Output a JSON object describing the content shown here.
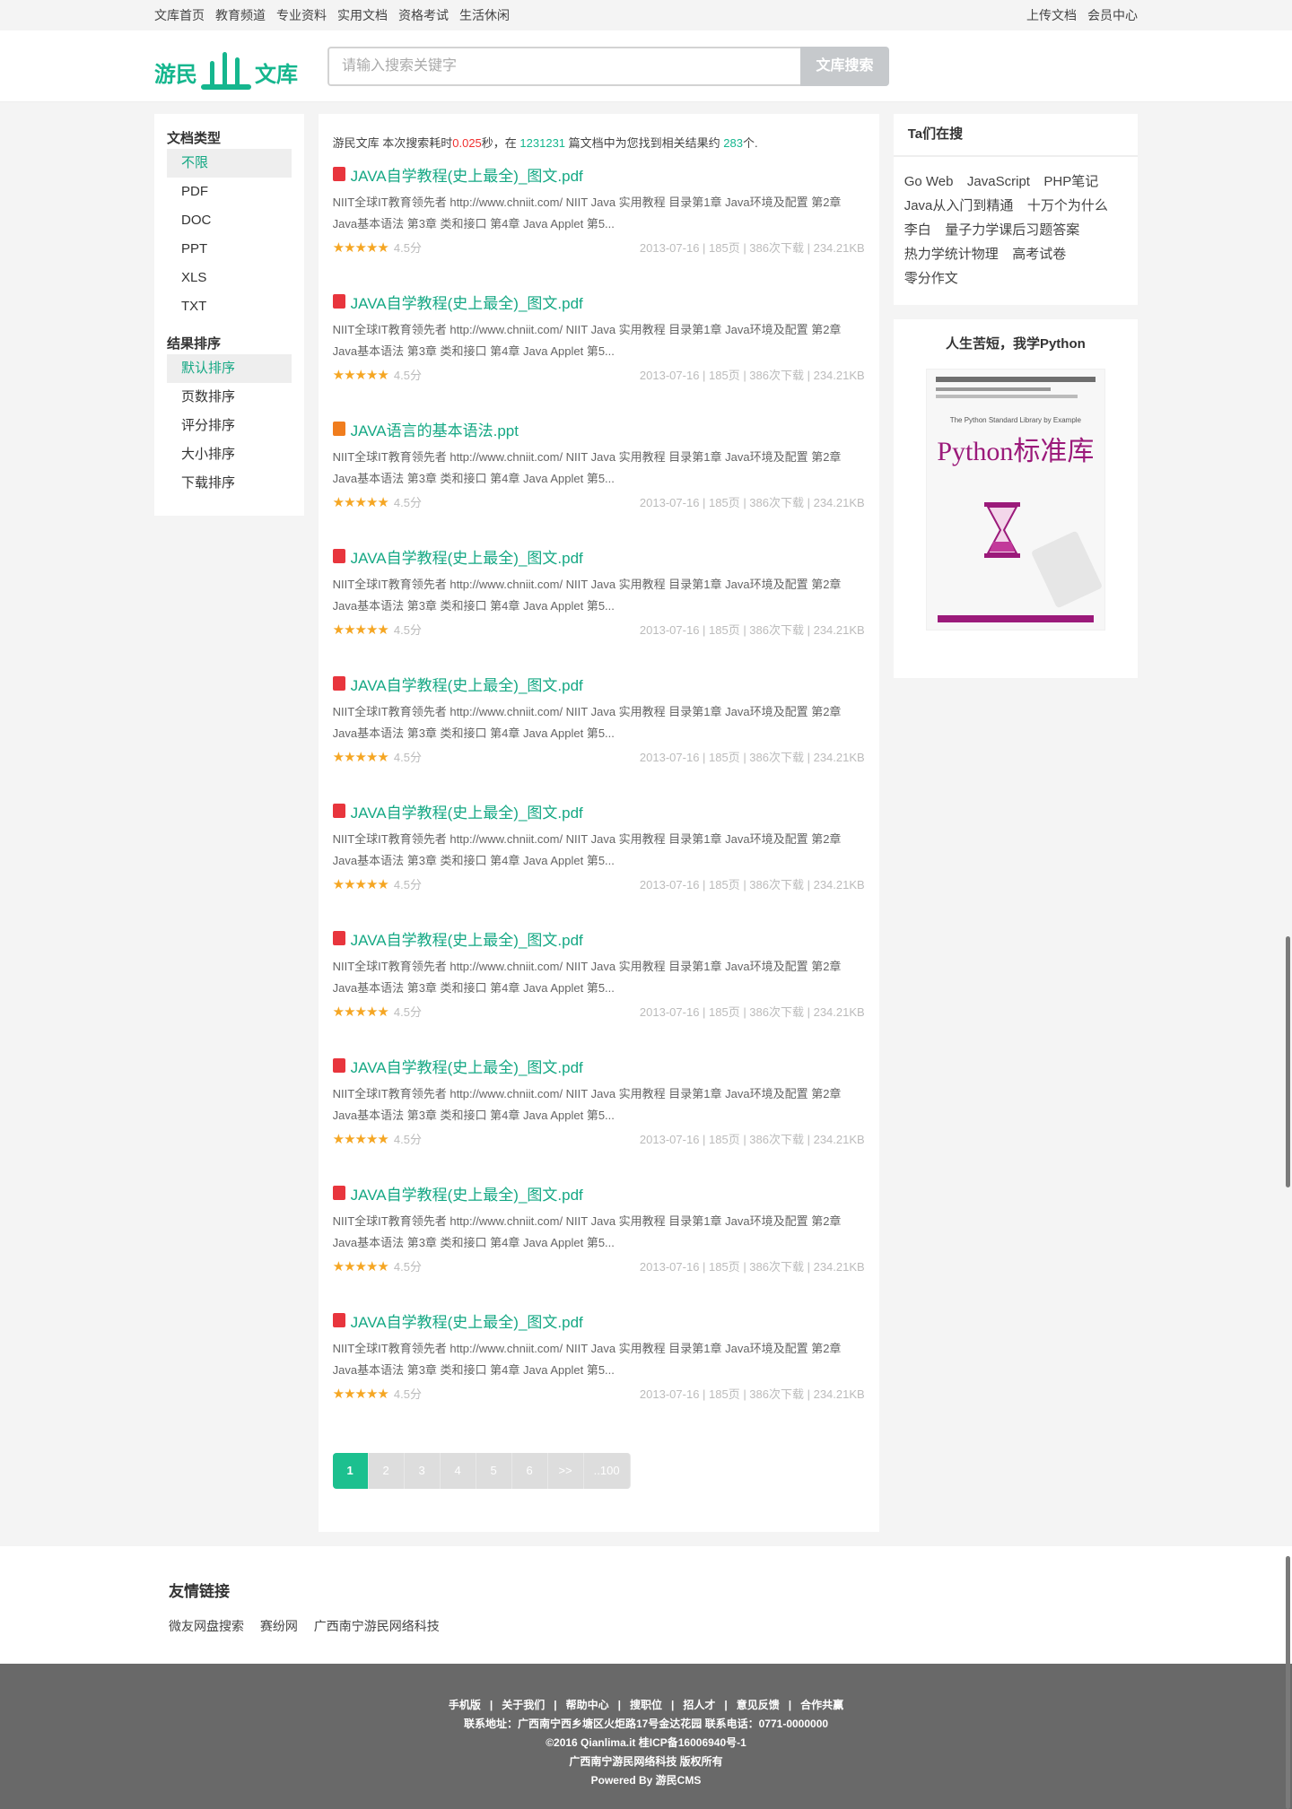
{
  "topnav": {
    "left": [
      "文库首页",
      "教育频道",
      "专业资料",
      "实用文档",
      "资格考试",
      "生活休闲"
    ],
    "right": [
      "上传文档",
      "会员中心"
    ]
  },
  "logo": {
    "part1": "游民",
    "part2": "文库"
  },
  "search": {
    "placeholder": "请输入搜索关键字",
    "button": "文库搜索"
  },
  "filters": {
    "type_title": "文档类型",
    "types": [
      "不限",
      "PDF",
      "DOC",
      "PPT",
      "XLS",
      "TXT"
    ],
    "sort_title": "结果排序",
    "sorts": [
      "默认排序",
      "页数排序",
      "评分排序",
      "大小排序",
      "下载排序"
    ]
  },
  "summary": {
    "prefix": "游民文库 本次搜索耗时",
    "time": "0.025",
    "mid1": "秒，在 ",
    "total": "1231231",
    "mid2": " 篇文档中为您找到相关结果约 ",
    "count": "283",
    "suffix": "个."
  },
  "results": [
    {
      "type": "pdf",
      "title": "JAVA自学教程(史上最全)_图文.pdf",
      "desc": "NIIT全球IT教育领先者 http://www.chniit.com/ NIIT Java 实用教程 目录第1章 Java环境及配置 第2章 Java基本语法 第3章 类和接口 第4章 Java Applet 第5...",
      "score": "4.5分",
      "info": "2013-07-16 | 185页 | 386次下载 | 234.21KB"
    },
    {
      "type": "pdf",
      "title": "JAVA自学教程(史上最全)_图文.pdf",
      "desc": "NIIT全球IT教育领先者 http://www.chniit.com/ NIIT Java 实用教程 目录第1章 Java环境及配置 第2章 Java基本语法 第3章 类和接口 第4章 Java Applet 第5...",
      "score": "4.5分",
      "info": "2013-07-16 | 185页 | 386次下载 | 234.21KB"
    },
    {
      "type": "ppt",
      "title": "JAVA语言的基本语法.ppt",
      "desc": "NIIT全球IT教育领先者 http://www.chniit.com/ NIIT Java 实用教程 目录第1章 Java环境及配置 第2章 Java基本语法 第3章 类和接口 第4章 Java Applet 第5...",
      "score": "4.5分",
      "info": "2013-07-16 | 185页 | 386次下载 | 234.21KB"
    },
    {
      "type": "pdf",
      "title": "JAVA自学教程(史上最全)_图文.pdf",
      "desc": "NIIT全球IT教育领先者 http://www.chniit.com/ NIIT Java 实用教程 目录第1章 Java环境及配置 第2章 Java基本语法 第3章 类和接口 第4章 Java Applet 第5...",
      "score": "4.5分",
      "info": "2013-07-16 | 185页 | 386次下载 | 234.21KB"
    },
    {
      "type": "pdf",
      "title": "JAVA自学教程(史上最全)_图文.pdf",
      "desc": "NIIT全球IT教育领先者 http://www.chniit.com/ NIIT Java 实用教程 目录第1章 Java环境及配置 第2章 Java基本语法 第3章 类和接口 第4章 Java Applet 第5...",
      "score": "4.5分",
      "info": "2013-07-16 | 185页 | 386次下载 | 234.21KB"
    },
    {
      "type": "pdf",
      "title": "JAVA自学教程(史上最全)_图文.pdf",
      "desc": "NIIT全球IT教育领先者 http://www.chniit.com/ NIIT Java 实用教程 目录第1章 Java环境及配置 第2章 Java基本语法 第3章 类和接口 第4章 Java Applet 第5...",
      "score": "4.5分",
      "info": "2013-07-16 | 185页 | 386次下载 | 234.21KB"
    },
    {
      "type": "pdf",
      "title": "JAVA自学教程(史上最全)_图文.pdf",
      "desc": "NIIT全球IT教育领先者 http://www.chniit.com/ NIIT Java 实用教程 目录第1章 Java环境及配置 第2章 Java基本语法 第3章 类和接口 第4章 Java Applet 第5...",
      "score": "4.5分",
      "info": "2013-07-16 | 185页 | 386次下载 | 234.21KB"
    },
    {
      "type": "pdf",
      "title": "JAVA自学教程(史上最全)_图文.pdf",
      "desc": "NIIT全球IT教育领先者 http://www.chniit.com/ NIIT Java 实用教程 目录第1章 Java环境及配置 第2章 Java基本语法 第3章 类和接口 第4章 Java Applet 第5...",
      "score": "4.5分",
      "info": "2013-07-16 | 185页 | 386次下载 | 234.21KB"
    },
    {
      "type": "pdf",
      "title": "JAVA自学教程(史上最全)_图文.pdf",
      "desc": "NIIT全球IT教育领先者 http://www.chniit.com/ NIIT Java 实用教程 目录第1章 Java环境及配置 第2章 Java基本语法 第3章 类和接口 第4章 Java Applet 第5...",
      "score": "4.5分",
      "info": "2013-07-16 | 185页 | 386次下载 | 234.21KB"
    },
    {
      "type": "pdf",
      "title": "JAVA自学教程(史上最全)_图文.pdf",
      "desc": "NIIT全球IT教育领先者 http://www.chniit.com/ NIIT Java 实用教程 目录第1章 Java环境及配置 第2章 Java基本语法 第3章 类和接口 第4章 Java Applet 第5...",
      "score": "4.5分",
      "info": "2013-07-16 | 185页 | 386次下载 | 234.21KB"
    }
  ],
  "rating_stars": "★★★★★",
  "pager": [
    "1",
    "2",
    "3",
    "4",
    "5",
    "6",
    ">>",
    "..100"
  ],
  "hot": {
    "title": "Ta们在搜",
    "tags": [
      "Go Web",
      "JavaScript",
      "PHP笔记",
      "Java从入门到精通",
      "十万个为什么",
      "李白",
      "量子力学课后习题答案",
      "热力学统计物理",
      "高考试卷",
      "零分作文"
    ]
  },
  "book": {
    "title": "人生苦短，我学Python",
    "cover_title": "Python标准库",
    "cover_subtitle": "The Python Standard Library by Example"
  },
  "friends": {
    "title": "友情链接",
    "links": [
      "微友网盘搜索",
      "赛纷网",
      "广西南宁游民网络科技"
    ]
  },
  "footer": {
    "links": [
      "手机版",
      "关于我们",
      "帮助中心",
      "搜职位",
      "招人才",
      "意见反馈",
      "合作共赢"
    ],
    "address": "联系地址：广西南宁西乡塘区火炬路17号金达花园 联系电话：0771-0000000",
    "copyright": "©2016 Qianlima.it 桂ICP备16006940号-1",
    "rights": "广西南宁游民网络科技 版权所有",
    "powered": "Powered By 游民CMS"
  },
  "colors": {
    "accent": "#15b68e",
    "time_red": "#f02f2f",
    "star": "#f5a623",
    "pdf_icon": "#e8353d",
    "ppt_icon": "#f07d1e"
  }
}
